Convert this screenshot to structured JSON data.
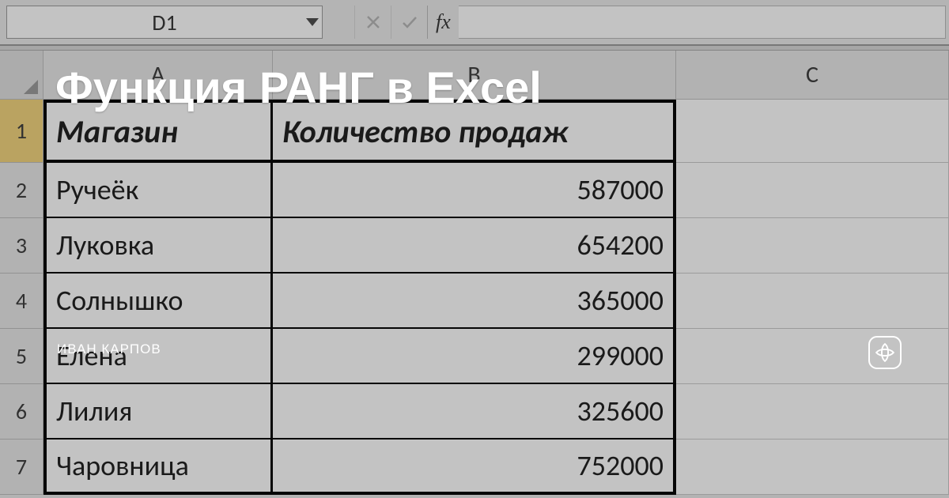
{
  "overlay": {
    "title": "Функция РАНГ в Excel",
    "author": "ИВАН КАРПОВ"
  },
  "formula_bar": {
    "cell_ref": "D1",
    "fx_label": "fx"
  },
  "columns": {
    "A": "A",
    "B": "B",
    "C": "C"
  },
  "rows": [
    "1",
    "2",
    "3",
    "4",
    "5",
    "6",
    "7"
  ],
  "table": {
    "headers": {
      "a": "Магазин",
      "b": "Количество продаж"
    },
    "data": [
      {
        "a": "Ручеёк",
        "b": "587000"
      },
      {
        "a": "Луковка",
        "b": "654200"
      },
      {
        "a": "Солнышко",
        "b": "365000"
      },
      {
        "a": "Елена",
        "b": "299000"
      },
      {
        "a": "Лилия",
        "b": "325600"
      },
      {
        "a": "Чаровница",
        "b": "752000"
      }
    ]
  }
}
